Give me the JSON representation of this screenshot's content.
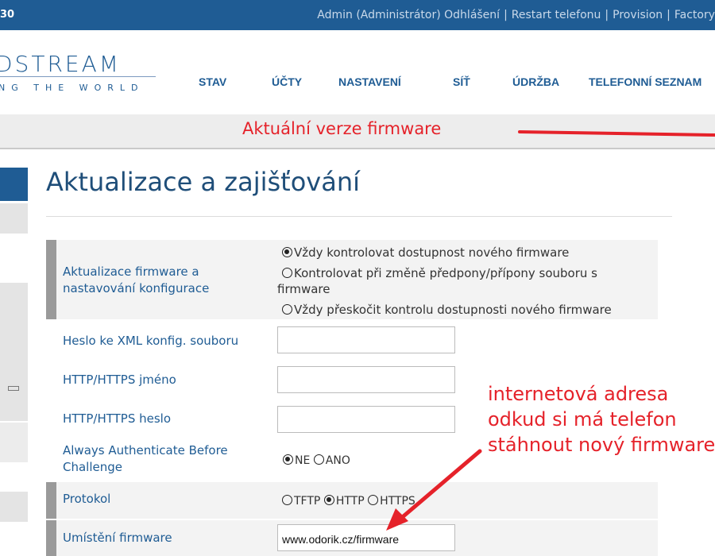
{
  "topbar": {
    "model": "30",
    "links": [
      "Admin (Administrátor) Odhlášení",
      "Restart telefonu",
      "Provision",
      "Factory"
    ]
  },
  "logo": {
    "main": "DSTREAM",
    "sub": "NG THE WORLD"
  },
  "nav": [
    "STAV",
    "ÚČTY",
    "NASTAVENÍ",
    "SÍŤ",
    "ÚDRŽBA",
    "TELEFONNÍ SEZNAM"
  ],
  "banner": "Aktuální verze firmware",
  "page_title": "Aktualizace a zajišťování",
  "settings": {
    "firmware_check": {
      "label": "Aktualizace firmware a nastavování konfigurace",
      "options": [
        "Vždy kontrolovat dostupnost nového firmware",
        "Kontrolovat při změně předpony/přípony souboru s firmware",
        "Vždy přeskočit kontrolu dostupnosti nového firmware"
      ],
      "selected": 0
    },
    "xml_password": {
      "label": "Heslo ke XML konfig. souboru",
      "value": ""
    },
    "http_user": {
      "label": "HTTP/HTTPS jméno",
      "value": ""
    },
    "http_pass": {
      "label": "HTTP/HTTPS heslo",
      "value": ""
    },
    "always_auth": {
      "label": "Always Authenticate Before Challenge",
      "options": [
        "NE",
        "ANO"
      ],
      "selected": "NE"
    },
    "protocol": {
      "label": "Protokol",
      "options": [
        "TFTP",
        "HTTP",
        "HTTPS"
      ],
      "selected": "HTTP"
    },
    "firmware_location": {
      "label": "Umístění firmware",
      "value": "www.odorik.cz/firmware"
    }
  },
  "annotation": [
    "internetová adresa",
    "odkud si má telefon",
    "stáhnout nový firmware"
  ],
  "colors": {
    "topbar": "#1f5c94",
    "nav_text": "#1f5c94",
    "annotation": "#e5222a",
    "label": "#1f5c94"
  }
}
